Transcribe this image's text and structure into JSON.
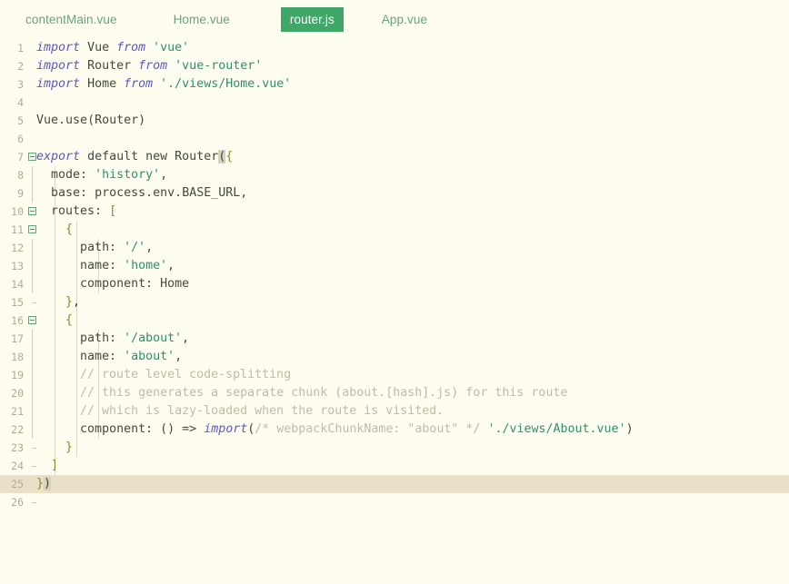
{
  "editor": {
    "background_color": "#fffdf0",
    "current_line_color": "#e8e0c7",
    "active_tab_color": "#3fa767",
    "string_color": "#2f9070",
    "keyword_color": "#5a57c8",
    "comment_color": "#b9bda7",
    "bracket_color": "#8a8a2e"
  },
  "tabs": [
    {
      "label": "contentMain.vue",
      "active": false
    },
    {
      "label": "Home.vue",
      "active": false
    },
    {
      "label": "router.js",
      "active": true
    },
    {
      "label": "App.vue",
      "active": false
    }
  ],
  "lines": [
    {
      "number": "1",
      "text": "import Vue from 'vue'"
    },
    {
      "number": "2",
      "text": "import Router from 'vue-router'"
    },
    {
      "number": "3",
      "text": "import Home from './views/Home.vue'"
    },
    {
      "number": "4",
      "text": ""
    },
    {
      "number": "5",
      "text": "Vue.use(Router)"
    },
    {
      "number": "6",
      "text": ""
    },
    {
      "number": "7",
      "text": "export default new Router({"
    },
    {
      "number": "8",
      "text": "  mode: 'history',"
    },
    {
      "number": "9",
      "text": "  base: process.env.BASE_URL,"
    },
    {
      "number": "10",
      "text": "  routes: ["
    },
    {
      "number": "11",
      "text": "    {"
    },
    {
      "number": "12",
      "text": "      path: '/',"
    },
    {
      "number": "13",
      "text": "      name: 'home',"
    },
    {
      "number": "14",
      "text": "      component: Home"
    },
    {
      "number": "15",
      "text": "    },"
    },
    {
      "number": "16",
      "text": "    {"
    },
    {
      "number": "17",
      "text": "      path: '/about',"
    },
    {
      "number": "18",
      "text": "      name: 'about',"
    },
    {
      "number": "19",
      "text": "      // route level code-splitting"
    },
    {
      "number": "20",
      "text": "      // this generates a separate chunk (about.[hash].js) for this route"
    },
    {
      "number": "21",
      "text": "      // which is lazy-loaded when the route is visited."
    },
    {
      "number": "22",
      "text": "      component: () => import(/* webpackChunkName: \"about\" */ './views/About.vue')"
    },
    {
      "number": "23",
      "text": "    }"
    },
    {
      "number": "24",
      "text": "  ]"
    },
    {
      "number": "25",
      "text": "})"
    },
    {
      "number": "26",
      "text": ""
    }
  ]
}
